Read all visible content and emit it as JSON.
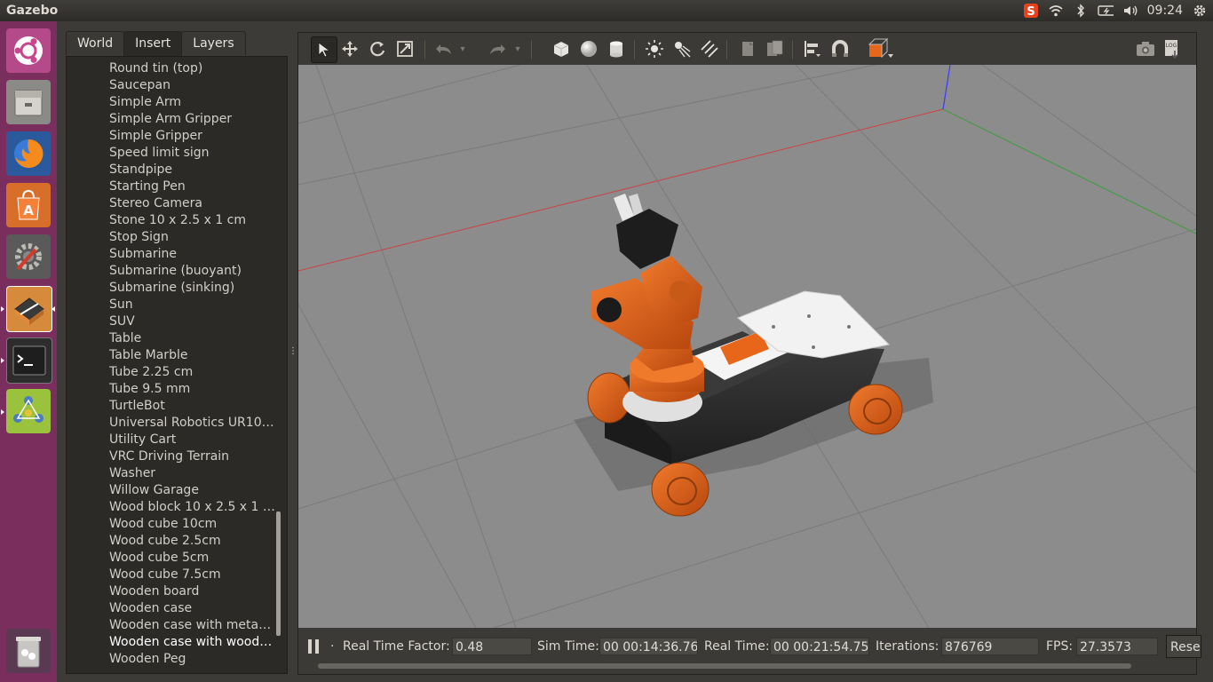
{
  "topbar": {
    "app_title": "Gazebo",
    "clock": "09:24",
    "tray_icons": [
      "sogou-input-icon",
      "wifi-icon",
      "bluetooth-icon",
      "battery-icon",
      "volume-icon",
      "settings-gear-icon"
    ]
  },
  "launcher": {
    "items": [
      {
        "name": "ubuntu-dash-icon"
      },
      {
        "name": "files-icon"
      },
      {
        "name": "firefox-icon"
      },
      {
        "name": "software-center-icon"
      },
      {
        "name": "system-settings-icon"
      },
      {
        "name": "gazebo-icon"
      },
      {
        "name": "terminal-icon"
      },
      {
        "name": "network-app-icon"
      },
      {
        "name": "trash-icon"
      }
    ]
  },
  "left_panel": {
    "tabs": [
      {
        "label": "World",
        "active": false
      },
      {
        "label": "Insert",
        "active": true
      },
      {
        "label": "Layers",
        "active": false
      }
    ],
    "items": [
      "Round tin (top)",
      "Saucepan",
      "Simple Arm",
      "Simple Arm Gripper",
      "Simple Gripper",
      "Speed limit sign",
      "Standpipe",
      "Starting Pen",
      "Stereo Camera",
      "Stone 10 x 2.5 x 1 cm",
      "Stop Sign",
      "Submarine",
      "Submarine (buoyant)",
      "Submarine (sinking)",
      "Sun",
      "SUV",
      "Table",
      "Table Marble",
      "Tube 2.25 cm",
      "Tube 9.5 mm",
      "TurtleBot",
      "Universal Robotics UR10…",
      "Utility Cart",
      "VRC Driving Terrain",
      "Washer",
      "Willow Garage",
      "Wood block 10 x 2.5 x 1 …",
      "Wood cube 10cm",
      "Wood cube 2.5cm",
      "Wood cube 5cm",
      "Wood cube 7.5cm",
      "Wooden board",
      "Wooden case",
      "Wooden case with meta…",
      "Wooden case with wood…",
      "Wooden Peg"
    ],
    "selected_index": 34
  },
  "toolbar": {
    "tools": [
      "select-arrow-icon",
      "translate-icon",
      "rotate-icon",
      "scale-icon",
      "undo-icon",
      "undo-dropdown-icon",
      "redo-icon",
      "redo-dropdown-icon",
      "box-shape-icon",
      "sphere-shape-icon",
      "cylinder-shape-icon",
      "point-light-icon",
      "spot-light-icon",
      "directional-light-icon",
      "copy-icon",
      "paste-icon",
      "align-icon",
      "snap-icon",
      "view-angle-icon",
      "screenshot-icon",
      "log-icon"
    ]
  },
  "stats": {
    "step_label": ".",
    "real_time_factor_label": "Real Time Factor:",
    "real_time_factor": "0.48",
    "sim_time_label": "Sim Time:",
    "sim_time": "00 00:14:36.769",
    "real_time_label": "Real Time:",
    "real_time": "00 00:21:54.751",
    "iterations_label": "Iterations:",
    "iterations": "876769",
    "fps_label": "FPS:",
    "fps": "27.3573",
    "reset_label": "Reset"
  },
  "colors": {
    "robot_orange": "#e8661a",
    "robot_dark": "#2a2a2a",
    "ground": "#8c8c8c",
    "launcher_bg": "#7a2e5e"
  }
}
